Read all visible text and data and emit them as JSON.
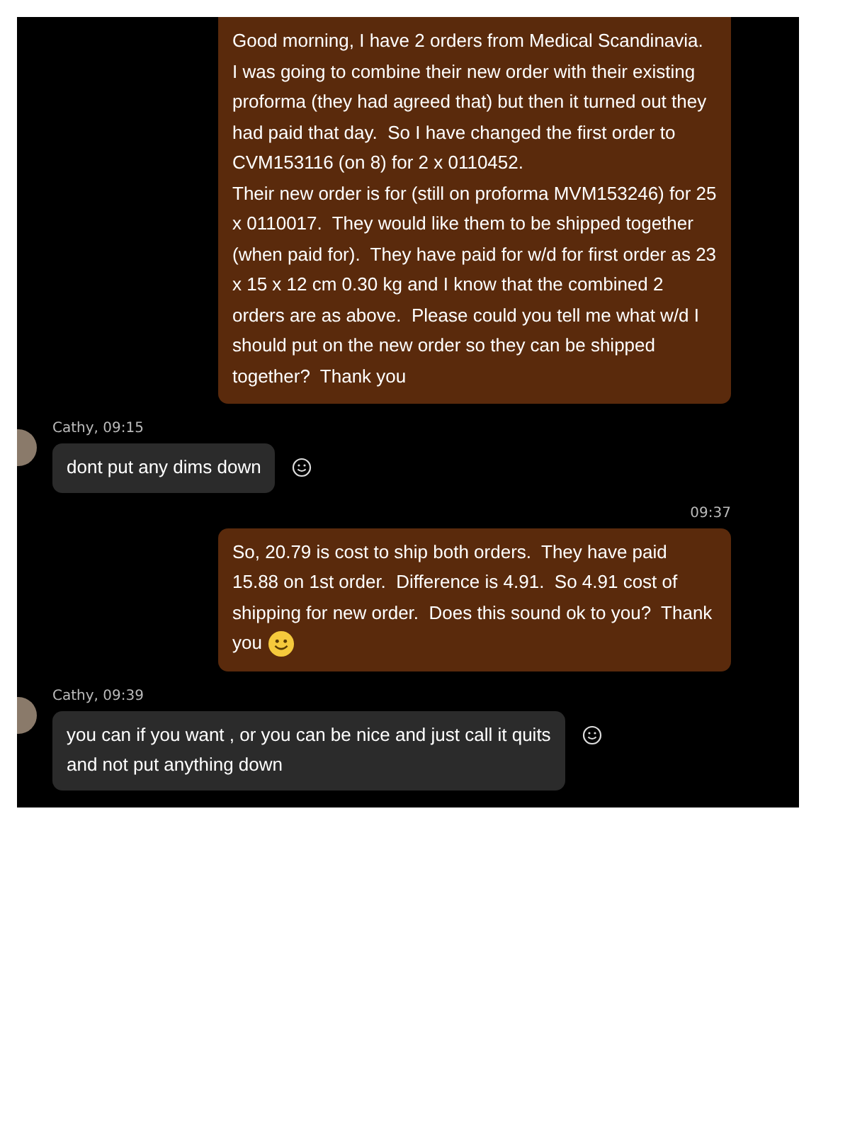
{
  "messages": [
    {
      "kind": "outgoing",
      "text": "Good morning, I have 2 orders from Medical Scandinavia.  I was going to combine their new order with their existing proforma (they had agreed that) but then it turned out they had paid that day.  So I have changed the first order to CVM153116 (on 8) for 2 x 0110452.\nTheir new order is for (still on proforma MVM153246) for 25 x 0110017.  They would like them to be shipped together (when paid for).  They have paid for w/d for first order as 23 x 15 x 12 cm 0.30 kg and I know that the combined 2 orders are as above.  Please could you tell me what w/d I should put on the new order so they can be shipped together?  Thank you",
      "emoji": false
    },
    {
      "kind": "incoming",
      "sender": "Cathy, 09:15",
      "text": "dont put any dims down"
    },
    {
      "kind": "outgoing",
      "time": "09:37",
      "text": "So, 20.79 is cost to ship both orders.  They have paid 15.88 on 1st order.  Difference is 4.91.  So 4.91 cost of shipping for new order.  Does this sound ok to you?  Thank you",
      "emoji": true
    },
    {
      "kind": "incoming",
      "sender": "Cathy, 09:39",
      "text": "you can if you want , or you can be nice and just call it quits and not put anything down"
    }
  ]
}
